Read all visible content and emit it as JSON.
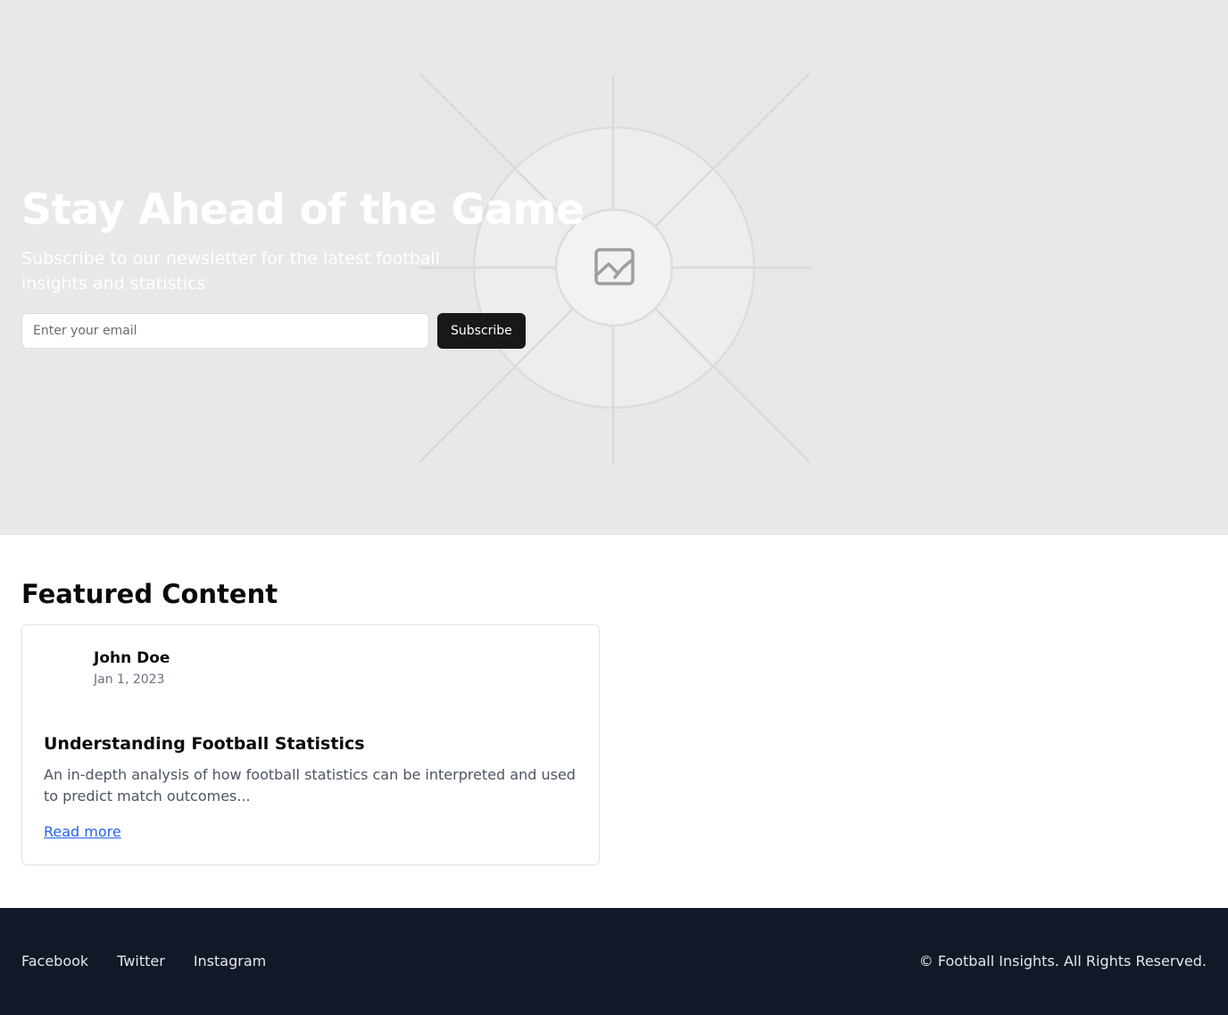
{
  "hero": {
    "title": "Stay Ahead of the Game",
    "subtitle": "Subscribe to our newsletter for the latest football insights and statistics.",
    "email_placeholder": "Enter your email",
    "subscribe_label": "Subscribe",
    "image_icon": "image-placeholder-icon"
  },
  "featured": {
    "heading": "Featured Content",
    "cards": [
      {
        "author": "John Doe",
        "date": "Jan 1, 2023",
        "title": "Understanding Football Statistics",
        "excerpt": "An in-depth analysis of how football statistics can be interpreted and used to predict match outcomes...",
        "link_label": "Read more"
      }
    ]
  },
  "footer": {
    "links": [
      "Facebook",
      "Twitter",
      "Instagram"
    ],
    "copyright": "© Football Insights. All Rights Reserved."
  },
  "colors": {
    "hero_bg": "#e8e8e8",
    "button_bg": "#18181b",
    "link": "#2563eb",
    "footer_bg": "#111827"
  }
}
